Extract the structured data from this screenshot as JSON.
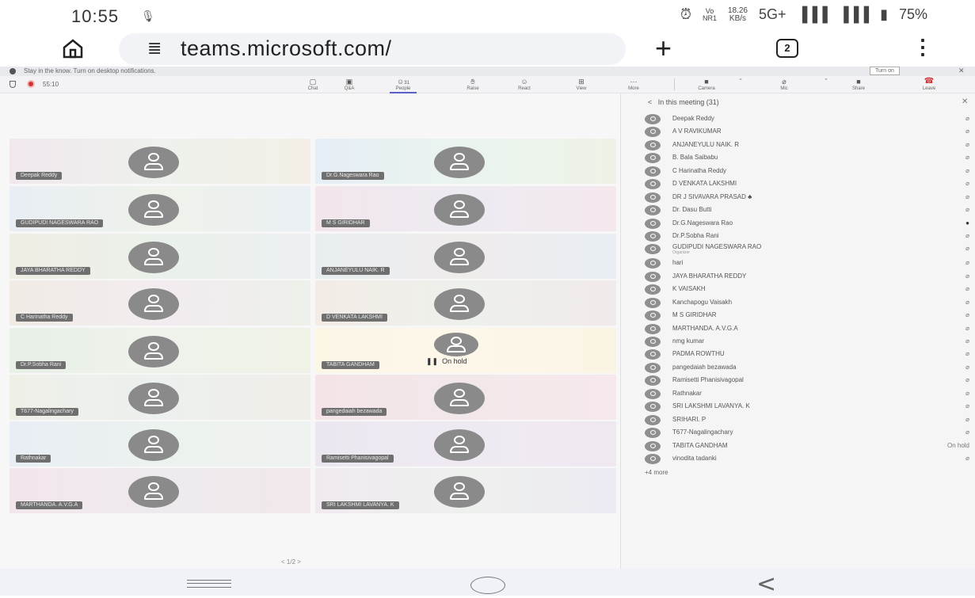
{
  "status_bar": {
    "time": "10:55",
    "net_speed_value": "18.26",
    "net_speed_unit": "KB/s",
    "network": "5G+",
    "battery": "75%",
    "volte": "Vo\nNR1"
  },
  "browser": {
    "url": "teams.microsoft.com/",
    "tab_count": "2"
  },
  "notification": {
    "text": "Stay in the know. Turn on desktop notifications.",
    "button": "Turn on"
  },
  "meeting": {
    "timer": "55:10",
    "toolbar": [
      {
        "label": "Chat",
        "icon": "chat-icon"
      },
      {
        "label": "Q&A",
        "icon": "qa-icon"
      },
      {
        "label": "People",
        "icon": "people-icon",
        "badge": "31"
      },
      {
        "label": "Raise",
        "icon": "raise-hand-icon"
      },
      {
        "label": "React",
        "icon": "react-icon"
      },
      {
        "label": "View",
        "icon": "view-icon"
      },
      {
        "label": "More",
        "icon": "more-icon"
      }
    ],
    "camera_label": "Camera",
    "mic_label": "Mic",
    "share_label": "Share",
    "leave_label": "Leave",
    "colors": {
      "leave": "#d13438",
      "accent": "#5b5fc7",
      "recording": "#d13438"
    }
  },
  "tiles": [
    {
      "name": "Deepak Reddy"
    },
    {
      "name": "Dr.G.Nageswara Rao"
    },
    {
      "name": "GUDIPUDI NAGESWARA RAO"
    },
    {
      "name": "M S GIRIDHAR"
    },
    {
      "name": "JAYA BHARATHA REDDY"
    },
    {
      "name": "ANJANEYULU NAIK. R"
    },
    {
      "name": "C Harinatha Reddy"
    },
    {
      "name": "D VENKATA LAKSHMI"
    },
    {
      "name": "Dr.P.Sobha Rani"
    },
    {
      "name": "TABITA GANDHAM",
      "status": "On hold"
    },
    {
      "name": "T677-Nagalingachary"
    },
    {
      "name": "pangedaiah bezawada"
    },
    {
      "name": "Rathnakar"
    },
    {
      "name": "Ramisetti Phanisivagopal"
    },
    {
      "name": "MARTHANDA. A.V.G.A"
    },
    {
      "name": "SRI LAKSHMI LAVANYA. K"
    }
  ],
  "pager": "< 1/2 >",
  "panel": {
    "title": "In this meeting (31)",
    "participants": [
      {
        "name": "Deepak Reddy",
        "right": "mic-off"
      },
      {
        "name": "A V RAVIKUMAR",
        "right": "mic-off"
      },
      {
        "name": "ANJANEYULU NAIK. R",
        "right": "mic-off"
      },
      {
        "name": "B. Bala Saibabu",
        "right": "mic-off"
      },
      {
        "name": "C Harinatha Reddy",
        "right": "mic-off"
      },
      {
        "name": "D VENKATA LAKSHMI",
        "right": "mic-off"
      },
      {
        "name": "DR J SIVAVARA PRASAD",
        "right": "mic-off"
      },
      {
        "name": "Dr. Dasu Butti",
        "right": "mic-off"
      },
      {
        "name": "Dr.G.Nageswara Rao",
        "right": "mic-on"
      },
      {
        "name": "Dr.P.Sobha Rani",
        "right": "mic-off"
      },
      {
        "name": "GUDIPUDI NAGESWARA RAO",
        "role": "Organizer",
        "right": "mic-off"
      },
      {
        "name": "hari",
        "right": "mic-off"
      },
      {
        "name": "JAYA BHARATHA REDDY",
        "right": "mic-off"
      },
      {
        "name": "K VAISAKH",
        "right": "mic-off"
      },
      {
        "name": "Kanchapogu Vaisakh",
        "right": "mic-off"
      },
      {
        "name": "M S GIRIDHAR",
        "right": "mic-off"
      },
      {
        "name": "MARTHANDA. A.V.G.A",
        "right": "mic-off"
      },
      {
        "name": "nmg kumar",
        "right": "mic-off"
      },
      {
        "name": "PADMA ROWTHU",
        "right": "mic-off"
      },
      {
        "name": "pangedaiah bezawada",
        "right": "mic-off"
      },
      {
        "name": "Ramisetti Phanisivagopal",
        "right": "mic-off"
      },
      {
        "name": "Rathnakar",
        "right": "mic-off"
      },
      {
        "name": "SRI LAKSHMI LAVANYA. K",
        "right": "mic-off"
      },
      {
        "name": "SRIHARI. P",
        "right": "mic-off"
      },
      {
        "name": "T677-Nagalingachary",
        "right": "mic-off"
      },
      {
        "name": "TABITA GANDHAM",
        "right_text": "On hold"
      },
      {
        "name": "vinodita tadanki",
        "right": "mic-off"
      }
    ],
    "more": "+4 more"
  }
}
